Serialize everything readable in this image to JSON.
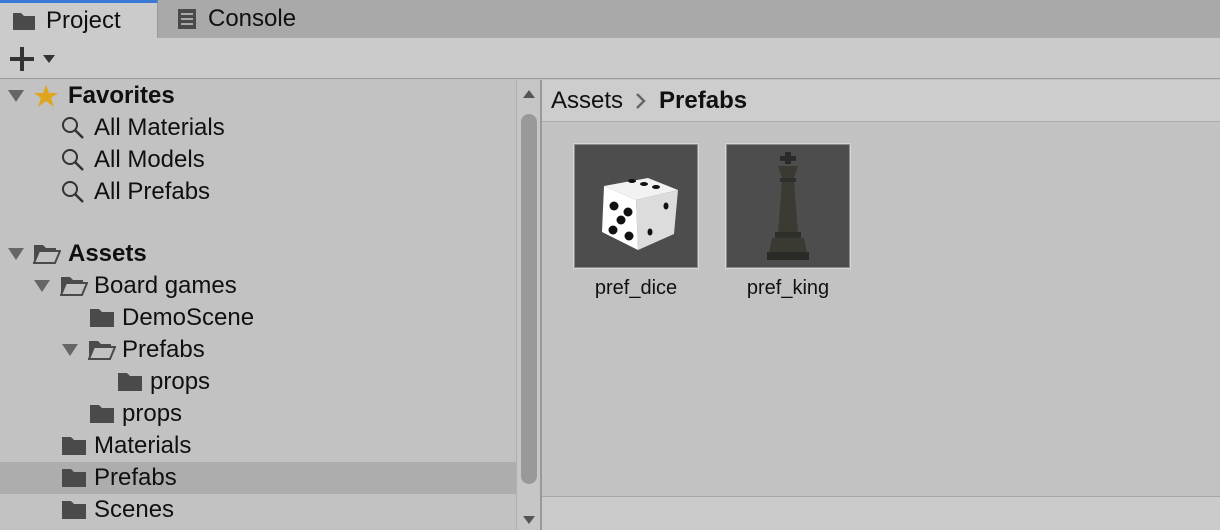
{
  "window": {
    "tabs": [
      {
        "label": "Project",
        "icon": "folder-icon",
        "active": true
      },
      {
        "label": "Console",
        "icon": "console-icon",
        "active": false
      }
    ]
  },
  "toolbar": {
    "create_icon": "plus-icon",
    "create_dropdown_icon": "caret-down-icon"
  },
  "tree": {
    "favorites": {
      "label": "Favorites",
      "items": [
        {
          "label": "All Materials",
          "icon": "search-icon"
        },
        {
          "label": "All Models",
          "icon": "search-icon"
        },
        {
          "label": "All Prefabs",
          "icon": "search-icon"
        }
      ]
    },
    "assets": {
      "label": "Assets",
      "items": [
        {
          "label": "Board games",
          "expanded": true,
          "depth": 1
        },
        {
          "label": "DemoScene",
          "depth": 2
        },
        {
          "label": "Prefabs",
          "expanded": true,
          "depth": 2
        },
        {
          "label": "props",
          "depth": 3
        },
        {
          "label": "props",
          "depth": 2
        },
        {
          "label": "Materials",
          "depth": 1
        },
        {
          "label": "Prefabs",
          "depth": 1,
          "selected": true
        },
        {
          "label": "Scenes",
          "depth": 1
        }
      ]
    }
  },
  "breadcrumb": {
    "root": "Assets",
    "current": "Prefabs"
  },
  "assets_grid": [
    {
      "name": "pref_dice",
      "thumbnail": "dice-thumbnail"
    },
    {
      "name": "pref_king",
      "thumbnail": "chess-king-thumbnail"
    }
  ],
  "colors": {
    "accent": "#3a79d6",
    "selected_row": "#adadad",
    "favorite_star": "#e0a51f",
    "thumb_bg": "#4d4d4d"
  }
}
